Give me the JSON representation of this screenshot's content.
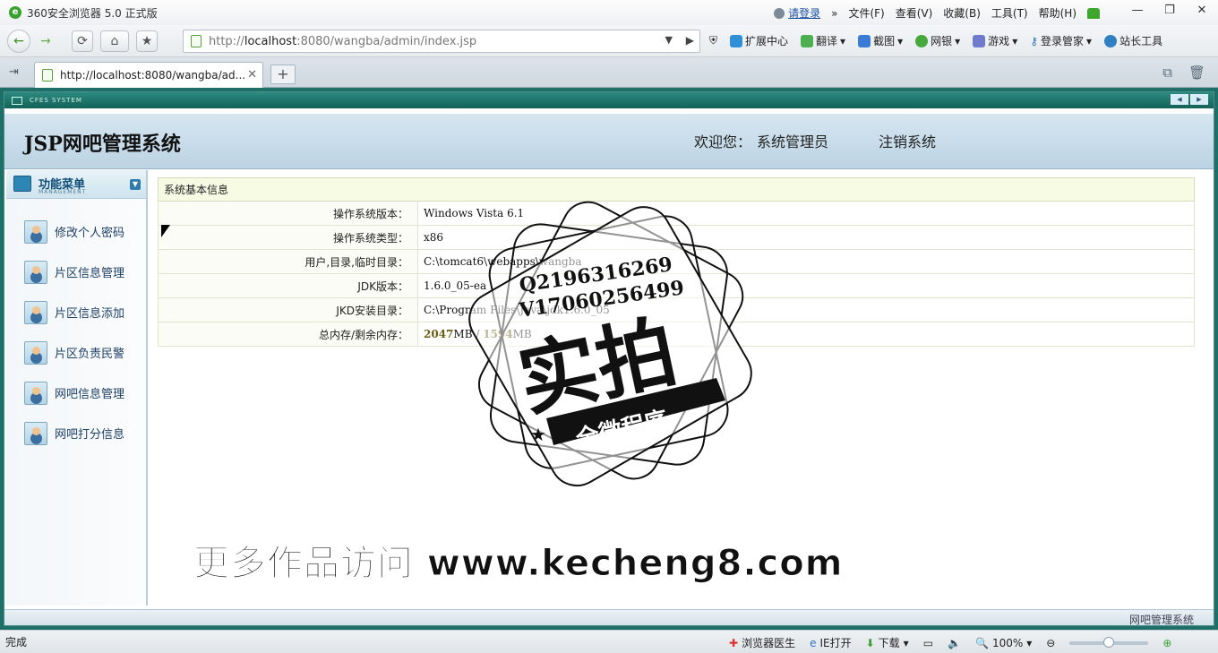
{
  "browser": {
    "title": "360安全浏览器 5.0 正式版",
    "login": "请登录",
    "menus": [
      "文件(F)",
      "查看(V)",
      "收藏(B)",
      "工具(T)",
      "帮助(H)"
    ],
    "address": {
      "prefix": "http://",
      "host": "localhost",
      "rest": ":8080/wangba/admin/index.jsp"
    },
    "tools": [
      "扩展中心",
      "翻译",
      "截图",
      "网银",
      "游戏",
      "登录管家",
      "站长工具"
    ],
    "tab_title": "http://localhost:8080/wangba/ad...",
    "status": "完成",
    "status_items": [
      "浏览器医生",
      "IE打开",
      "下载"
    ],
    "zoom": "100%",
    "zoom_level": 0.5
  },
  "app": {
    "system_label": "CFES SYSTEM",
    "title": "JSP网吧管理系统",
    "welcome_label": "欢迎您：",
    "user": "系统管理员",
    "logout": "注销系统",
    "footer": "网吧管理系统"
  },
  "menu": {
    "title": "功能菜单",
    "subtitle": "MANAGEMENT",
    "items": [
      "修改个人密码",
      "片区信息管理",
      "片区信息添加",
      "片区负责民警",
      "网吧信息管理",
      "网吧打分信息"
    ]
  },
  "info": {
    "heading": "系统基本信息",
    "rows": [
      {
        "label": "操作系统版本：",
        "value": "Windows Vista 6.1"
      },
      {
        "label": "操作系统类型：",
        "value": "x86"
      },
      {
        "label": "用户,目录,临时目录：",
        "value": "C:\\tomcat6\\webapps\\wangba"
      },
      {
        "label": "JDK版本：",
        "value": "1.6.0_05-ea"
      },
      {
        "label": "JKD安装目录：",
        "value": "C:\\Program Files\\Java\\jdk1.6.0_05"
      },
      {
        "label": "总内存/剩余内存：",
        "mem_total": "2047",
        "mem_sep": "MB / ",
        "mem_free": "1594",
        "mem_unit": "MB"
      }
    ]
  },
  "overlay": {
    "stamp_qq": "Q2196316269",
    "stamp_v": "V17060256499",
    "stamp_main": "实拍",
    "stamp_banner": "全微程序",
    "watermark": "更多作品访问 www.kecheng8.com"
  }
}
